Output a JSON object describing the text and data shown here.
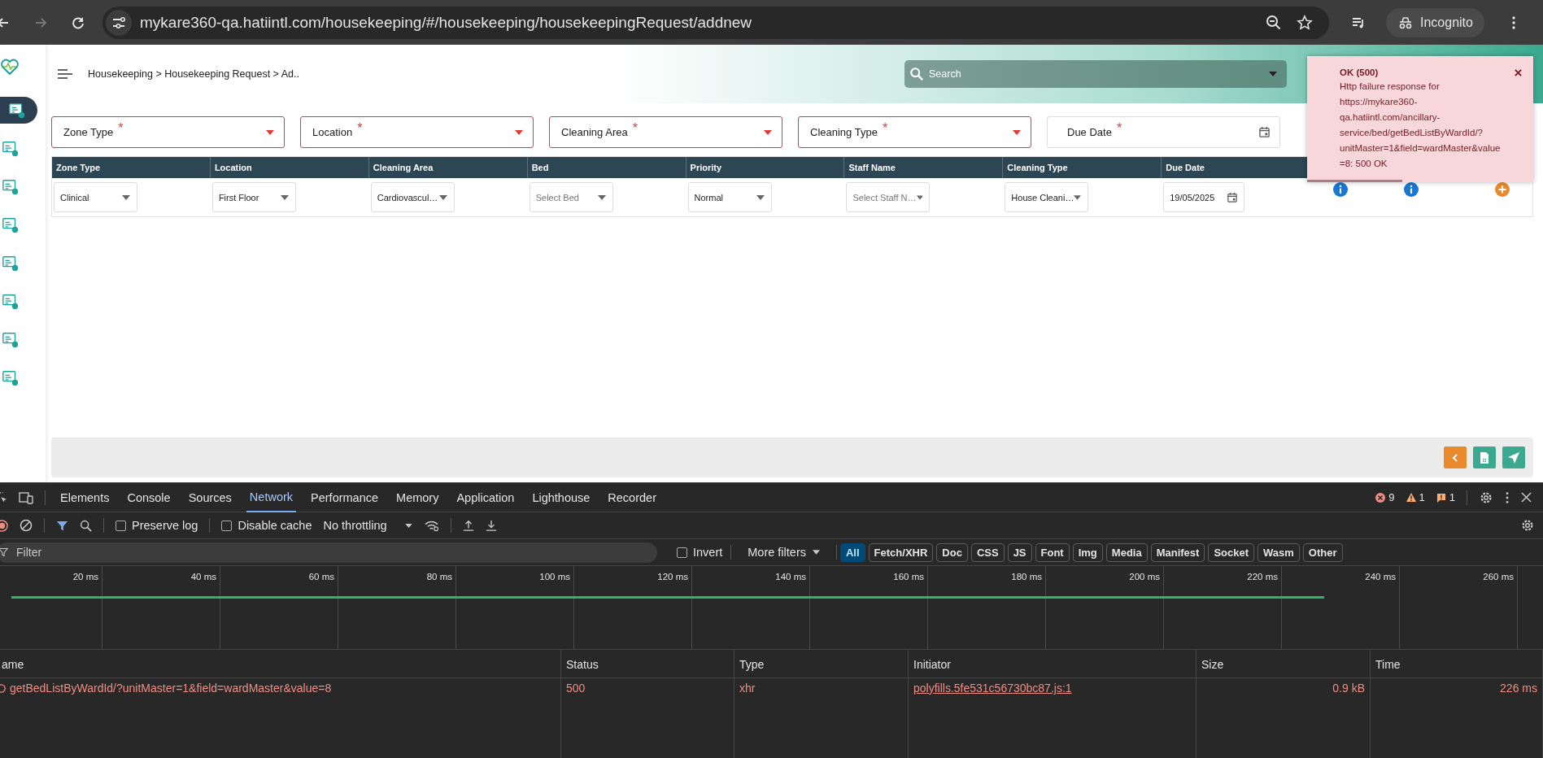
{
  "browser": {
    "url": "mykare360-qa.hatiintl.com/housekeeping/#/housekeeping/housekeepingRequest/addnew",
    "profile": "Incognito"
  },
  "sidebar": {
    "items": [
      {
        "selected": true
      },
      {
        "selected": false
      },
      {
        "selected": false
      },
      {
        "selected": false
      },
      {
        "selected": false
      },
      {
        "selected": false
      },
      {
        "selected": false
      },
      {
        "selected": false
      }
    ]
  },
  "header": {
    "breadcrumb": "Housekeeping > Housekeeping Request > Ad..",
    "search": {
      "placeholder": "Search"
    }
  },
  "filters": [
    {
      "label": "Zone Type",
      "marker": "*",
      "kind": "select"
    },
    {
      "label": "Location",
      "marker": "*",
      "kind": "select"
    },
    {
      "label": "Cleaning Area",
      "marker": "*",
      "kind": "select"
    },
    {
      "label": "Cleaning Type",
      "marker": "*",
      "kind": "select"
    },
    {
      "label": "Due Date",
      "marker": "*",
      "kind": "date"
    }
  ],
  "table": {
    "columns": [
      "Zone Type",
      "Location",
      "Cleaning Area",
      "Bed",
      "Priority",
      "Staff Name",
      "Cleaning Type",
      "Due Date"
    ],
    "rows": [
      {
        "cells": [
          {
            "kind": "select",
            "value": "Clinical"
          },
          {
            "kind": "select",
            "value": "First Floor"
          },
          {
            "kind": "select",
            "value": "Cardiovascul…"
          },
          {
            "kind": "select",
            "placeholder": "Select Bed"
          },
          {
            "kind": "select",
            "value": "Normal"
          },
          {
            "kind": "select",
            "placeholder": "Select Staff N…"
          },
          {
            "kind": "select",
            "value": "House Cleani…"
          },
          {
            "kind": "date",
            "value": "19/05/2025"
          },
          {
            "kind": "info"
          },
          {
            "kind": "info"
          },
          {
            "kind": "add"
          }
        ]
      }
    ]
  },
  "toast": {
    "title": "OK (500)",
    "message": "Http failure response for https://mykare360-qa.hatiintl.com/ancillary-service/bed/getBedListByWardId/?unitMaster=1&field=wardMaster&value=8: 500 OK",
    "level": 0.42
  },
  "devtools": {
    "tabs": [
      {
        "label": "Elements",
        "selected": false
      },
      {
        "label": "Console",
        "selected": false
      },
      {
        "label": "Sources",
        "selected": false
      },
      {
        "label": "Network",
        "selected": true
      },
      {
        "label": "Performance",
        "selected": false
      },
      {
        "label": "Memory",
        "selected": false
      },
      {
        "label": "Application",
        "selected": false
      },
      {
        "label": "Lighthouse",
        "selected": false
      },
      {
        "label": "Recorder",
        "selected": false
      }
    ],
    "counts": {
      "errors": "9",
      "warnings": "1",
      "issues": "1"
    },
    "toolbar": {
      "preserve_log": {
        "label": "Preserve log",
        "checked": false
      },
      "disable_cache": {
        "label": "Disable cache",
        "checked": false
      },
      "throttling": "No throttling"
    },
    "filter": {
      "placeholder": "Filter",
      "invert": {
        "label": "Invert",
        "checked": false
      },
      "more_filters": "More filters",
      "types": [
        {
          "label": "All",
          "selected": true
        },
        {
          "label": "Fetch/XHR",
          "selected": false
        },
        {
          "label": "Doc",
          "selected": false
        },
        {
          "label": "CSS",
          "selected": false
        },
        {
          "label": "JS",
          "selected": false
        },
        {
          "label": "Font",
          "selected": false
        },
        {
          "label": "Img",
          "selected": false
        },
        {
          "label": "Media",
          "selected": false
        },
        {
          "label": "Manifest",
          "selected": false
        },
        {
          "label": "Socket",
          "selected": false
        },
        {
          "label": "Wasm",
          "selected": false
        },
        {
          "label": "Other",
          "selected": false
        }
      ]
    },
    "timeline": {
      "ticks": [
        "20 ms",
        "40 ms",
        "60 ms",
        "80 ms",
        "100 ms",
        "120 ms",
        "140 ms",
        "160 ms",
        "180 ms",
        "200 ms",
        "220 ms",
        "240 ms",
        "260 ms"
      ]
    },
    "requests": {
      "columns": [
        "ame",
        "Status",
        "Type",
        "Initiator",
        "Size",
        "Time"
      ],
      "rows": [
        {
          "failed": true,
          "name": "getBedListByWardId/?unitMaster=1&field=wardMaster&value=8",
          "status": "500",
          "type": "xhr",
          "initiator": "polyfills.5fe531c56730bc87.js:1",
          "size": "0.9 kB",
          "time": "226 ms"
        }
      ]
    }
  }
}
